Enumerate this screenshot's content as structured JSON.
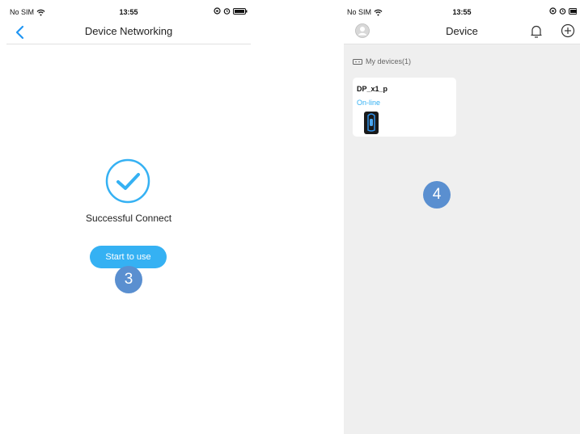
{
  "left_screen": {
    "status_bar": {
      "carrier": "No SIM",
      "time": "13:55"
    },
    "nav": {
      "title": "Device Networking"
    },
    "success_text": "Successful Connect",
    "start_button": "Start to use",
    "step_marker": "3"
  },
  "right_screen": {
    "status_bar": {
      "carrier": "No SIM",
      "time": "13:55"
    },
    "nav": {
      "title": "Device"
    },
    "section_label": "My devices(1)",
    "device": {
      "name": "DP_x1_p",
      "status": "On-line"
    },
    "step_marker": "4"
  },
  "colors": {
    "accent": "#35b1f3",
    "marker": "#5a8fd0",
    "right_background": "#efefef"
  },
  "icons": [
    "wifi-icon",
    "alarm-icon",
    "battery-icon",
    "back-chevron-icon",
    "check-circle-icon",
    "avatar-icon",
    "bell-icon",
    "add-circle-icon",
    "device-list-icon"
  ]
}
